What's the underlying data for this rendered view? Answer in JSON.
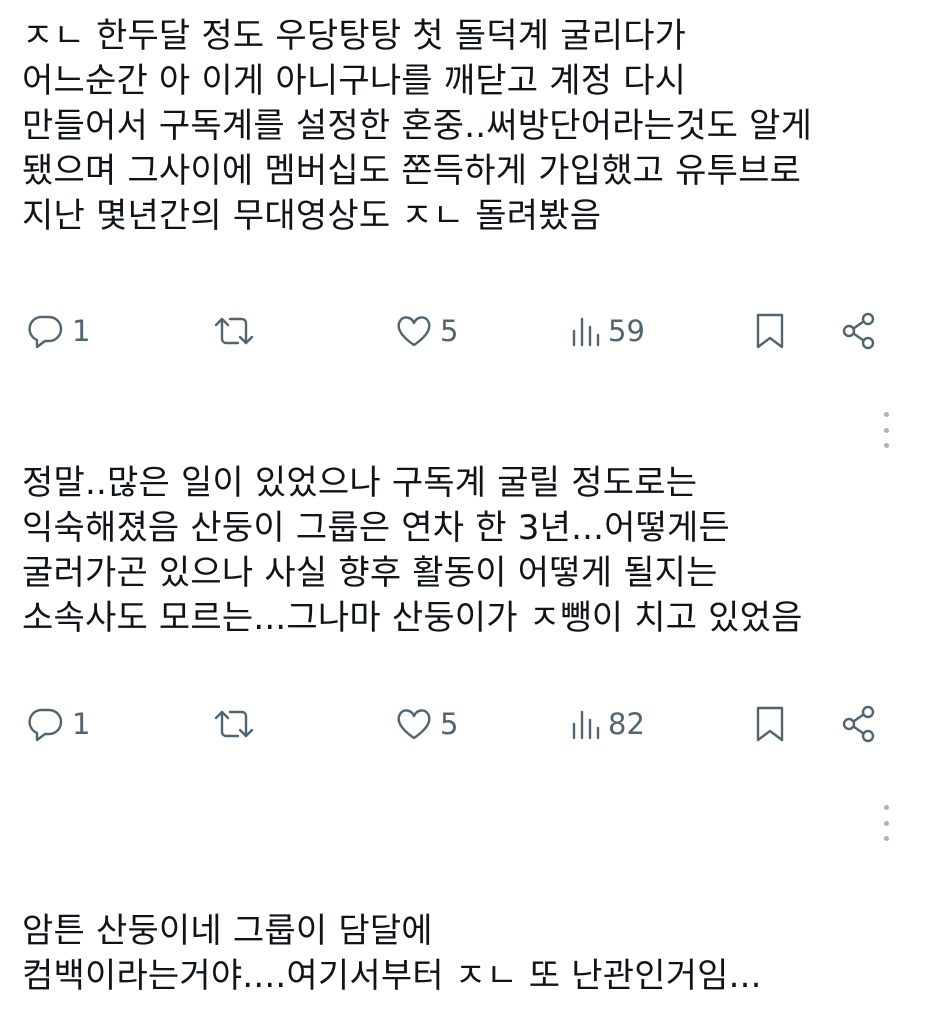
{
  "posts": [
    {
      "lines": [
        "ㅈㄴ 한두달 정도 우당탕탕 첫 돌덕계 굴리다가",
        "어느순간 아 이게 아니구나를 깨닫고 계정 다시",
        "만들어서 구독계를 설정한 혼중..써방단어라는것도 알게",
        "됐으며 그사이에 멤버십도 쫀득하게 가입했고 유투브로",
        "지난 몇년간의 무대영상도 ㅈㄴ 돌려봤음"
      ],
      "replies": "1",
      "retweets": "",
      "likes": "5",
      "views": "59"
    },
    {
      "lines": [
        "정말..많은 일이 있었으나 구독계 굴릴 정도로는",
        "익숙해졌음 산둥이 그룹은 연차 한 3년...어떻게든",
        "굴러가곤 있으나 사실 향후 활동이 어떻게 될지는",
        "소속사도 모르는...그나마 산둥이가 ㅈ뺑이 치고 있었음"
      ],
      "replies": "1",
      "retweets": "",
      "likes": "5",
      "views": "82"
    },
    {
      "lines": [
        "암튼 산둥이네 그룹이 담달에",
        "컴백이라는거야....여기서부터 ㅈㄴ 또 난관인거임..."
      ]
    }
  ],
  "icons": {
    "reply": "reply-icon",
    "retweet": "retweet-icon",
    "like": "heart-icon",
    "views": "views-chart-icon",
    "bookmark": "bookmark-icon",
    "share": "share-icon",
    "more": "more-vertical-icon"
  },
  "colors": {
    "text": "#0f1419",
    "secondary": "#536471",
    "dots": "#aab4bd"
  }
}
